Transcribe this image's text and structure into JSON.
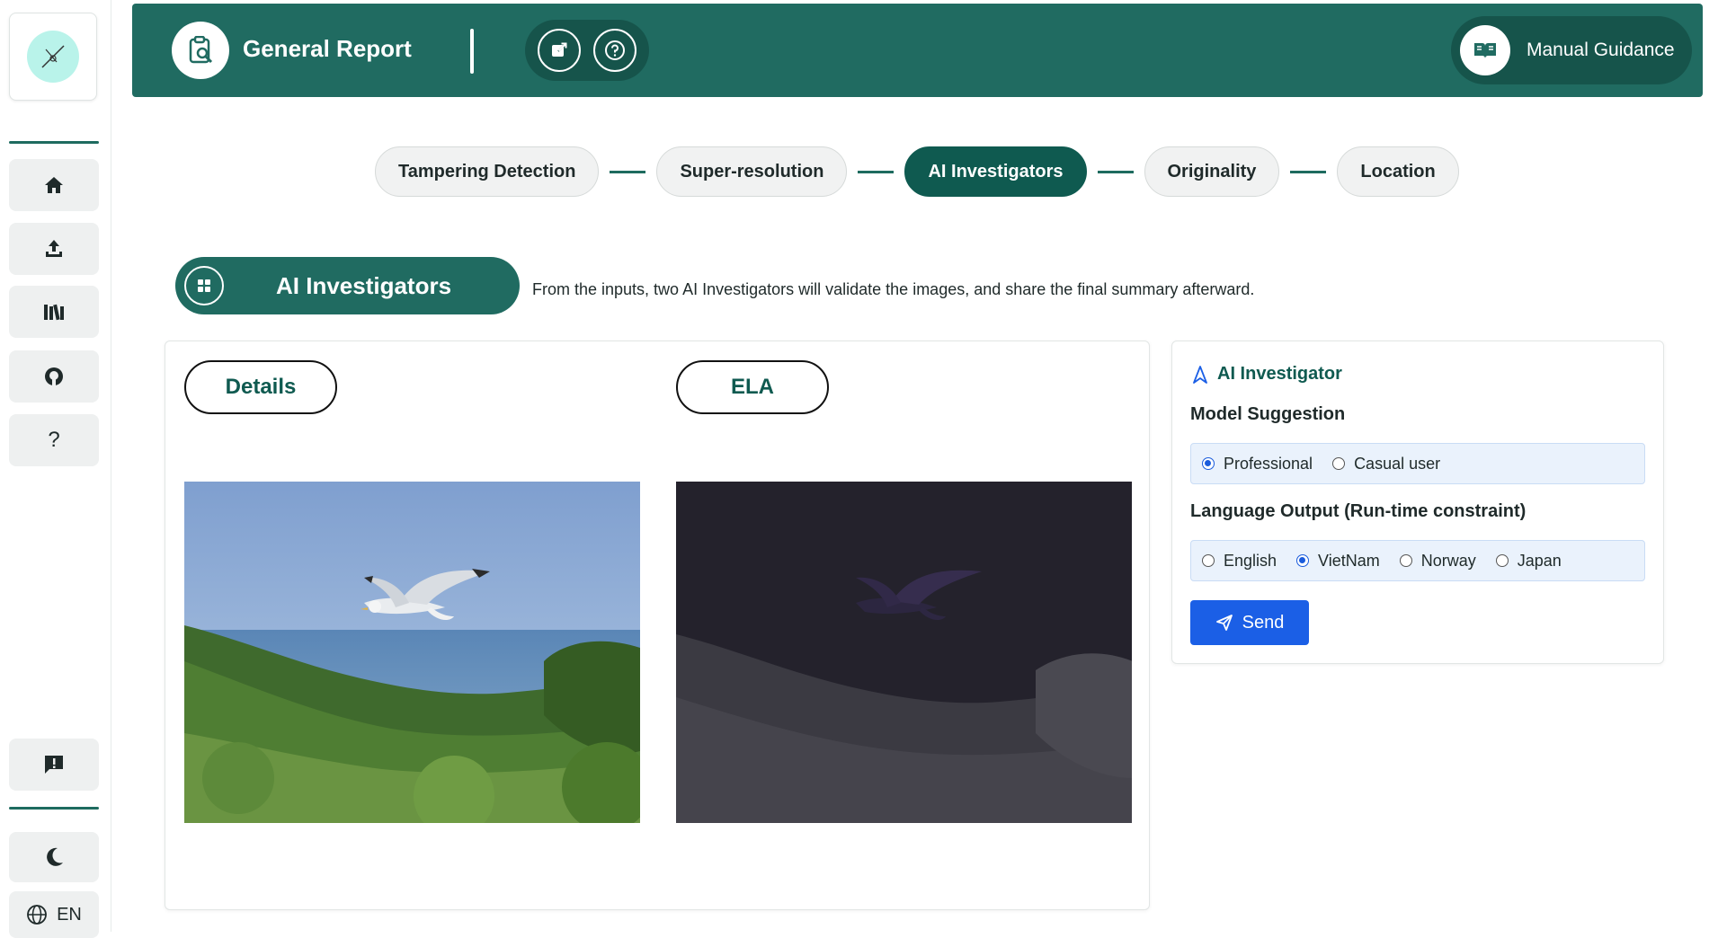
{
  "header": {
    "title": "General Report",
    "manual_label": "Manual Guidance"
  },
  "sidebar": {
    "language": "EN"
  },
  "stepper": {
    "steps": [
      "Tampering Detection",
      "Super-resolution",
      "AI Investigators",
      "Originality",
      "Location"
    ],
    "active": "AI Investigators"
  },
  "section": {
    "title": "AI Investigators",
    "description": "From the inputs, two AI Investigators will validate the images, and share the final summary afterward."
  },
  "images": {
    "details_label": "Details",
    "ela_label": "ELA"
  },
  "ai_panel": {
    "title": "AI Investigator",
    "model_heading": "Model Suggestion",
    "model_options": [
      "Professional",
      "Casual user"
    ],
    "model_selected": "Professional",
    "language_heading": "Language Output (Run-time constraint)",
    "language_options": [
      "English",
      "VietNam",
      "Norway",
      "Japan"
    ],
    "language_selected": "VietNam",
    "send_label": "Send"
  },
  "colors": {
    "primary": "#206b61",
    "primary_dark": "#0f5a50",
    "send": "#1b5fe6"
  }
}
